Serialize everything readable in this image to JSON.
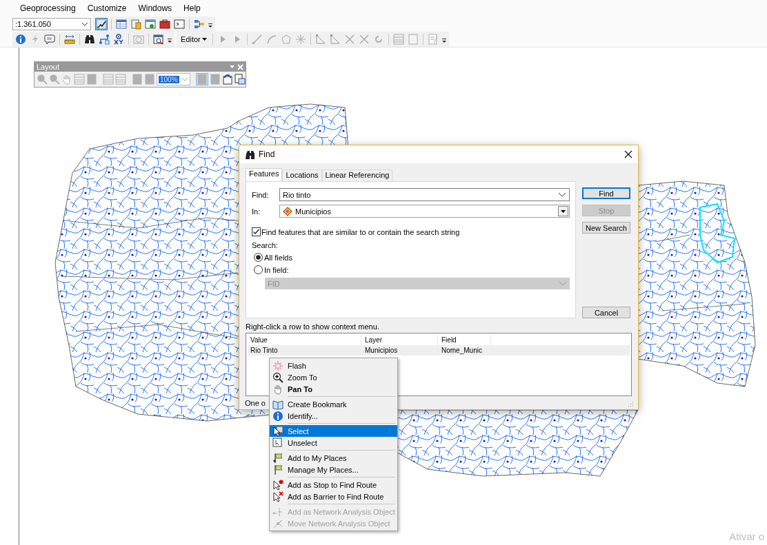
{
  "menu_bar": [
    {
      "label": "Geoprocessing"
    },
    {
      "label": "Customize"
    },
    {
      "label": "Windows"
    },
    {
      "label": "Help"
    }
  ],
  "scale_box": {
    "value": ":1.361.050"
  },
  "editor_menu": {
    "label": "Editor"
  },
  "layout_toolbar": {
    "title": "Layout",
    "zoom_value": "100%"
  },
  "find_dialog": {
    "title": "Find",
    "tabs": [
      {
        "label": "Features",
        "selected": true
      },
      {
        "label": "Locations",
        "selected": false
      },
      {
        "label": "Linear Referencing",
        "selected": false
      }
    ],
    "find_label": "Find:",
    "find_value": "Rio tinto",
    "in_label": "In:",
    "in_value": "Municipios",
    "similar": {
      "label": "Find features that are similar to or contain the search string",
      "checked": true
    },
    "search_label": "Search:",
    "search_options": [
      {
        "label": "All fields",
        "selected": true
      },
      {
        "label": "In field:",
        "selected": false
      }
    ],
    "field_select": {
      "value": "FID",
      "disabled": true
    },
    "buttons": [
      {
        "label": "Find",
        "disabled": false,
        "default": true
      },
      {
        "label": "Stop",
        "disabled": true,
        "default": false
      },
      {
        "label": "New Search",
        "disabled": false,
        "default": false
      },
      {
        "label": "Cancel",
        "disabled": false,
        "default": false
      }
    ],
    "hint": "Right-click a row to show context menu.",
    "results": {
      "columns": [
        "Value",
        "Layer",
        "Field"
      ],
      "rows": [
        [
          "Rio Tinto",
          "Municipios",
          "Nome_Munic"
        ]
      ]
    },
    "status": "One o"
  },
  "context_menu": {
    "groups": [
      [
        {
          "label": "Flash",
          "selected": false,
          "disabled": false,
          "default": false
        },
        {
          "label": "Zoom To",
          "selected": false,
          "disabled": false,
          "default": false
        },
        {
          "label": "Pan To",
          "selected": false,
          "disabled": false,
          "default": true
        }
      ],
      [
        {
          "label": "Create Bookmark",
          "selected": false,
          "disabled": false,
          "default": false
        },
        {
          "label": "Identify...",
          "selected": false,
          "disabled": false,
          "default": false
        }
      ],
      [
        {
          "label": "Select",
          "selected": true,
          "disabled": false,
          "default": false
        },
        {
          "label": "Unselect",
          "selected": false,
          "disabled": false,
          "default": false
        }
      ],
      [
        {
          "label": "Add to My Places",
          "selected": false,
          "disabled": false,
          "default": false
        },
        {
          "label": "Manage My Places...",
          "selected": false,
          "disabled": false,
          "default": false
        }
      ],
      [
        {
          "label": "Add as Stop to Find Route",
          "selected": false,
          "disabled": false,
          "default": false
        },
        {
          "label": "Add as Barrier to Find Route",
          "selected": false,
          "disabled": false,
          "default": false
        }
      ],
      [
        {
          "label": "Add as Network Analysis Object",
          "selected": false,
          "disabled": true,
          "default": false
        },
        {
          "label": "Move Network Analysis Object",
          "selected": false,
          "disabled": true,
          "default": false
        }
      ]
    ]
  },
  "activation_notice": "Ativar o"
}
